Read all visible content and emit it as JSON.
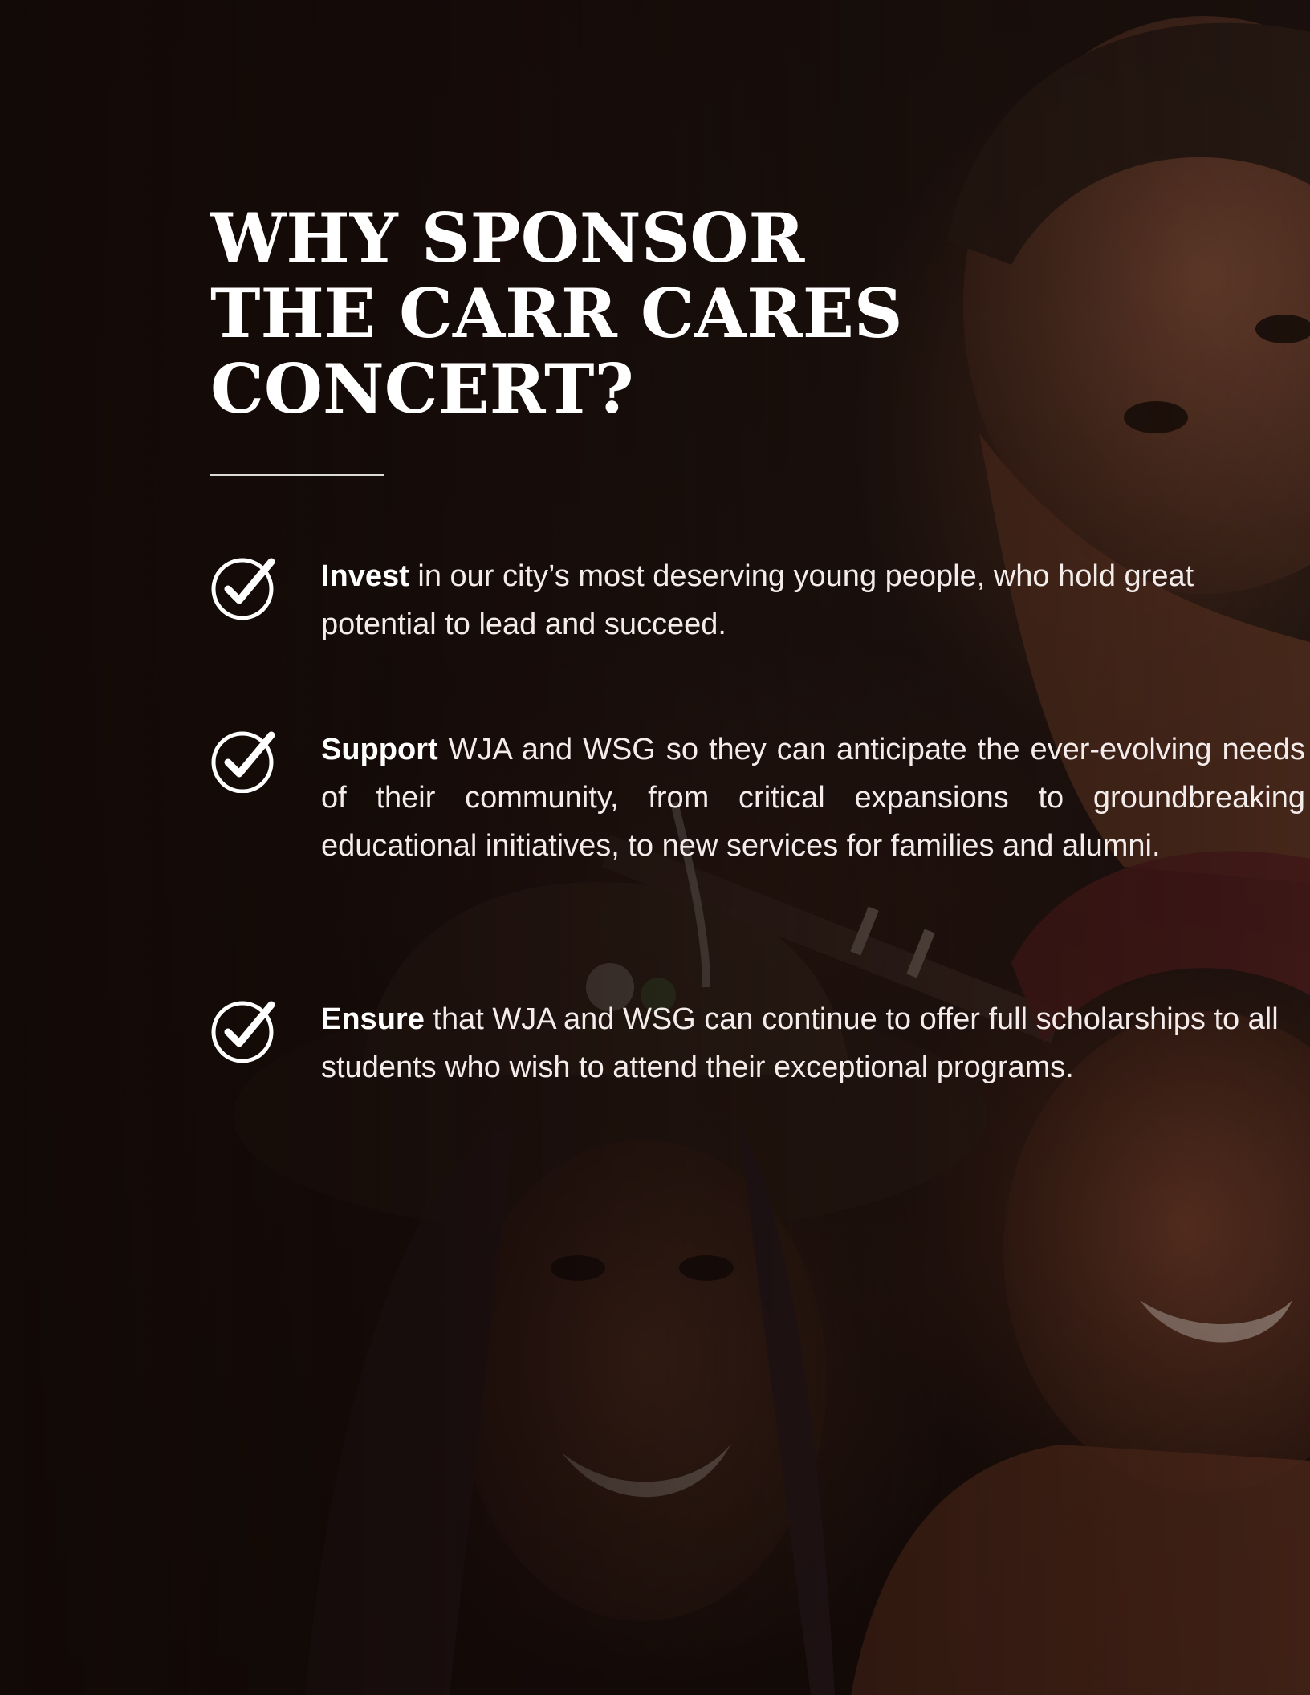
{
  "heading": {
    "line1": "WHY SPONSOR",
    "line2": "THE CARR CARES",
    "line3": "CONCERT?"
  },
  "benefits": [
    {
      "icon": "check-circle-icon",
      "lead": "Invest",
      "text": " in our city’s most deserving young people, who hold great potential to lead and succeed."
    },
    {
      "icon": "check-circle-icon",
      "lead": "Support",
      "text": " WJA and WSG so they can anticipate the ever-evolving needs of their community, from critical expansions to groundbreaking educational initiatives, to new services for families and alumni."
    },
    {
      "icon": "check-circle-icon",
      "lead": "Ensure",
      "text": " that WJA and WSG can continue to offer full scholarships to all students who wish to attend their exceptional programs."
    }
  ],
  "colors": {
    "background": "#1b110e",
    "text": "#ffffff"
  }
}
